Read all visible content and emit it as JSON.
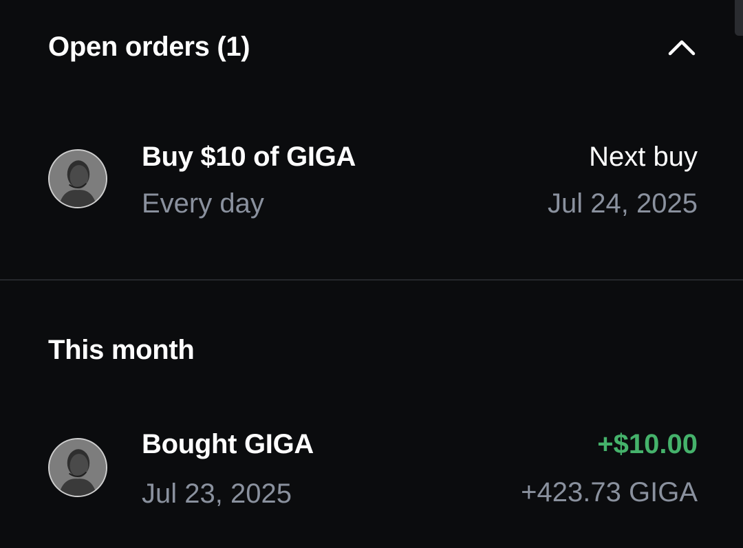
{
  "open_orders": {
    "header": "Open orders (1)",
    "toggle_icon": "chevron-up-icon",
    "orders": [
      {
        "title": "Buy $10 of GIGA",
        "frequency": "Every day",
        "next_label": "Next buy",
        "next_date": "Jul 24, 2025",
        "icon": "giga-token-avatar"
      }
    ]
  },
  "this_month": {
    "header": "This month",
    "transactions": [
      {
        "title": "Bought GIGA",
        "date": "Jul 23, 2025",
        "amount_usd": "+$10.00",
        "amount_token": "+423.73 GIGA",
        "icon": "giga-token-avatar"
      }
    ]
  },
  "colors": {
    "background": "#0b0c0e",
    "primary_text": "#ffffff",
    "secondary_text": "#8a919e",
    "positive": "#45b26b",
    "divider": "#26282c"
  }
}
